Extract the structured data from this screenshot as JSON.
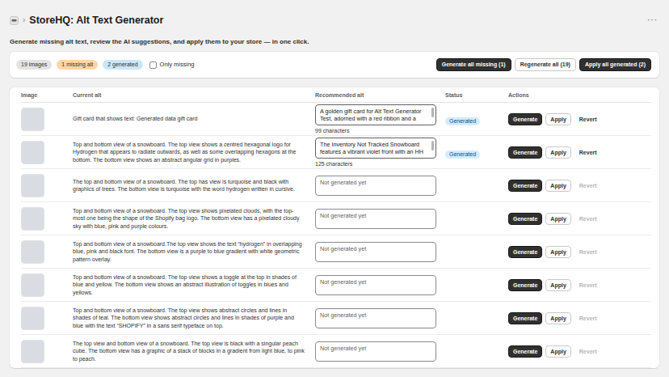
{
  "header": {
    "separator": "›",
    "title": "StoreHQ: Alt Text Generator",
    "menu": "···"
  },
  "intro": "Generate missing alt text, review the AI suggestions, and apply them to your store — in one click.",
  "toolbar": {
    "badges": [
      {
        "label": "19 images",
        "color": "#e3e3e3"
      },
      {
        "label": "1 missing alt",
        "color": "#ffd6a4"
      },
      {
        "label": "2 generated",
        "color": "#cbe7f7"
      }
    ],
    "filter": {
      "label": "Only missing",
      "checked": false
    },
    "buttons": [
      {
        "label": "Generate all missing (1)",
        "kind": "primary"
      },
      {
        "label": "Regenerate all (19)",
        "kind": "secondary"
      },
      {
        "label": "Apply all generated (2)",
        "kind": "primary"
      }
    ]
  },
  "table": {
    "columns": [
      "Image",
      "Current alt",
      "Recommended alt",
      "Status",
      "Actions"
    ],
    "rows": [
      {
        "current_alt": "Gift card that shows text: Generated data gift card",
        "generated": true,
        "recommended": "A golden gift card for Alt Text Generator Test, adorned with a red ribbon and a",
        "placeholder": "",
        "char_count": "99 characters",
        "status": "Generated",
        "actions": [
          {
            "label": "Generate",
            "kind": "primary",
            "disabled": false
          },
          {
            "label": "Apply",
            "kind": "secondary",
            "disabled": false
          },
          {
            "label": "Revert",
            "kind": "plain",
            "disabled": false
          }
        ]
      },
      {
        "current_alt": "Top and bottom view of a snowboard. The top view shows a centred hexagonal logo for Hydrogen that appears to radiate outwards, as well as some overlapping hexagons at the bottom. The bottom view shows an abstract angular grid in purples.",
        "generated": true,
        "recommended": "The Inventory Not Tracked Snowboard features a vibrant violet front with an HH",
        "placeholder": "",
        "char_count": "125 characters",
        "status": "Generated",
        "actions": [
          {
            "label": "Generate",
            "kind": "primary",
            "disabled": false
          },
          {
            "label": "Apply",
            "kind": "secondary",
            "disabled": false
          },
          {
            "label": "Revert",
            "kind": "plain",
            "disabled": false
          }
        ]
      },
      {
        "current_alt": "The top and bottom view of a snowboard. The top has view is turquoise and black with graphics of trees. The bottom view is turquoise with the word hydrogen written in cursive.",
        "generated": false,
        "recommended": "",
        "placeholder": "Not generated yet",
        "char_count": "",
        "status": "",
        "actions": [
          {
            "label": "Generate",
            "kind": "primary",
            "disabled": false
          },
          {
            "label": "Apply",
            "kind": "secondary",
            "disabled": false
          },
          {
            "label": "Revert",
            "kind": "plain",
            "disabled": true
          }
        ]
      },
      {
        "current_alt": "Top and bottom view of a snowboard. The top view shows pixelated clouds, with the top-most one being the shape of the Shopify bag logo. The bottom view has a pixelated cloudy sky with blue, pink and purple colours.",
        "generated": false,
        "recommended": "",
        "placeholder": "Not generated yet",
        "char_count": "",
        "status": "",
        "actions": [
          {
            "label": "Generate",
            "kind": "primary",
            "disabled": false
          },
          {
            "label": "Apply",
            "kind": "secondary",
            "disabled": false
          },
          {
            "label": "Revert",
            "kind": "plain",
            "disabled": true
          }
        ]
      },
      {
        "current_alt": "Top and bottom view of a snowboard.The top view shows the text “hydrogen” in overlapping blue, pink and black font. The bottom view is a purple to blue gradient with white geometric pattern overlay.",
        "generated": false,
        "recommended": "",
        "placeholder": "Not generated yet",
        "char_count": "",
        "status": "",
        "actions": [
          {
            "label": "Generate",
            "kind": "primary",
            "disabled": false
          },
          {
            "label": "Apply",
            "kind": "secondary",
            "disabled": false
          },
          {
            "label": "Revert",
            "kind": "plain",
            "disabled": true
          }
        ]
      },
      {
        "current_alt": "Top and bottom view of a snowboard. The top view shows a toggle at the top in shades of blue and yellow. The bottom view shows an abstract illustration of toggles in blues and yellows.",
        "generated": false,
        "recommended": "",
        "placeholder": "Not generated yet",
        "char_count": "",
        "status": "",
        "actions": [
          {
            "label": "Generate",
            "kind": "primary",
            "disabled": false
          },
          {
            "label": "Apply",
            "kind": "secondary",
            "disabled": false
          },
          {
            "label": "Revert",
            "kind": "plain",
            "disabled": true
          }
        ]
      },
      {
        "current_alt": "Top and bottom view of a snowboard. The top view shows abstract circles and lines in shades of teal. The bottom view shows abstract circles and lines in shades of purple and blue with the text “SHOPIFY” in a sans serif typeface on top.",
        "generated": false,
        "recommended": "",
        "placeholder": "Not generated yet",
        "char_count": "",
        "status": "",
        "actions": [
          {
            "label": "Generate",
            "kind": "primary",
            "disabled": false
          },
          {
            "label": "Apply",
            "kind": "secondary",
            "disabled": false
          },
          {
            "label": "Revert",
            "kind": "plain",
            "disabled": true
          }
        ]
      },
      {
        "current_alt": "The top view and bottom view of a snowboard. The top view is black with a singular peach cube. The bottom view has a graphic of a stack of blocks in a gradient from light blue, to pink to peach.",
        "generated": false,
        "recommended": "",
        "placeholder": "Not generated yet",
        "char_count": "",
        "status": "",
        "actions": [
          {
            "label": "Generate",
            "kind": "primary",
            "disabled": false
          },
          {
            "label": "Apply",
            "kind": "secondary",
            "disabled": false
          },
          {
            "label": "Revert",
            "kind": "plain",
            "disabled": true
          }
        ]
      }
    ]
  }
}
